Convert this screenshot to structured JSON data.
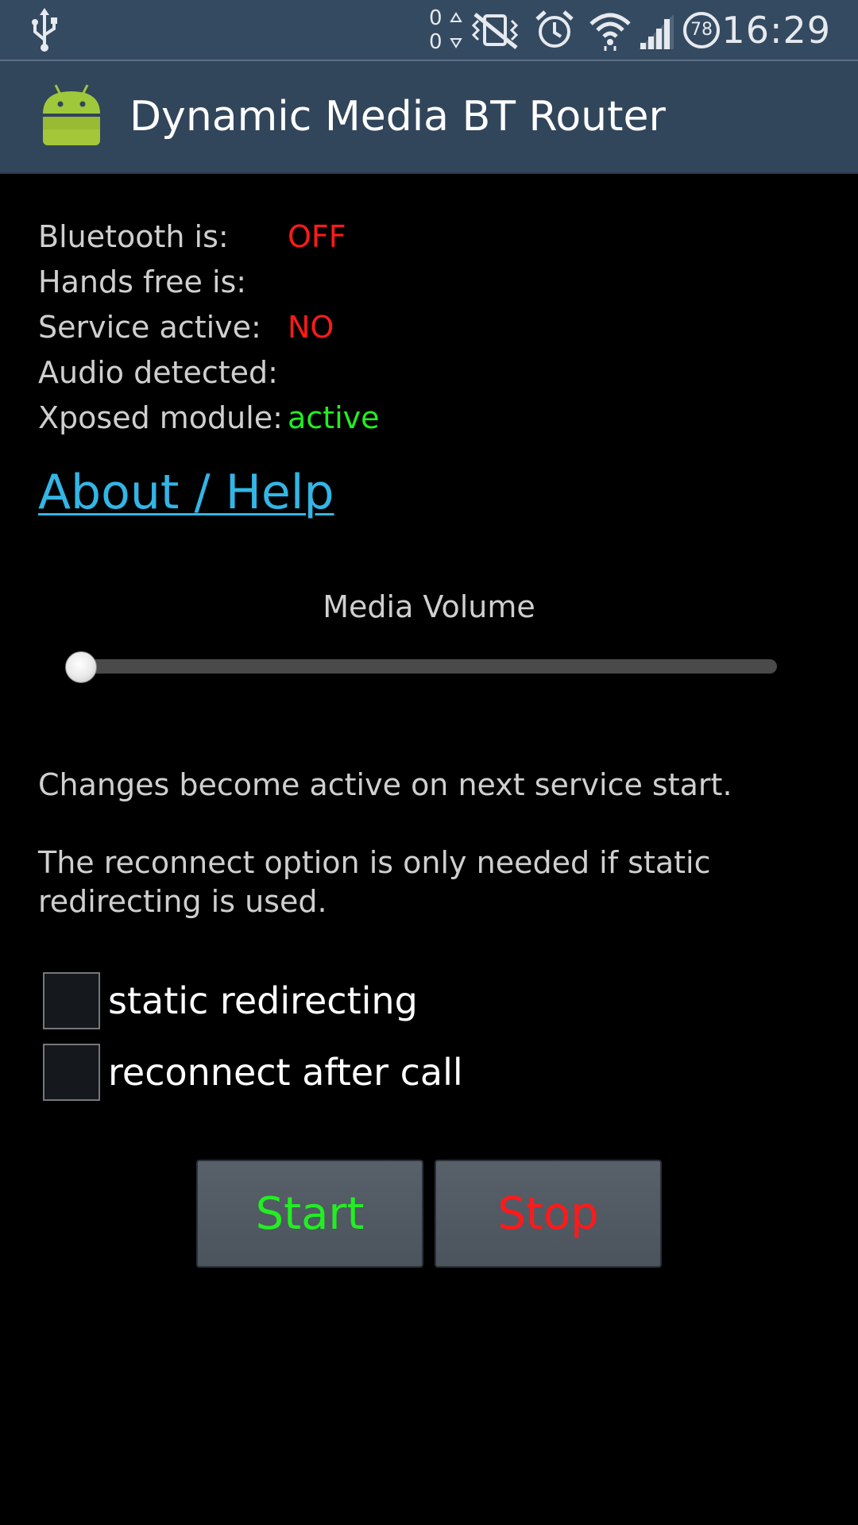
{
  "statusbar": {
    "time": "16:29",
    "battery": "78",
    "data_in": "0",
    "data_out": "0",
    "icons": [
      "usb-icon",
      "data-activity-icon",
      "vibrate-mute-icon",
      "alarm-icon",
      "wifi-icon",
      "signal-icon",
      "battery-icon"
    ]
  },
  "actionbar": {
    "title": "Dynamic Media BT Router",
    "icon": "android-icon"
  },
  "status": {
    "bluetooth_label": "Bluetooth is:",
    "bluetooth_value": "OFF",
    "handsfree_label": "Hands free is:",
    "handsfree_value": "",
    "service_label": "Service active:",
    "service_value": "NO",
    "audio_label": "Audio detected:",
    "audio_value": "",
    "xposed_label": "Xposed module:",
    "xposed_value": "active"
  },
  "help_link": "About / Help",
  "volume": {
    "label": "Media Volume",
    "level": 0
  },
  "notes": {
    "line1": "Changes become active on next service start.",
    "line2": "The reconnect option is only needed if static redirecting is used."
  },
  "options": [
    {
      "label": "static redirecting",
      "checked": false
    },
    {
      "label": "reconnect after call",
      "checked": false
    }
  ],
  "buttons": {
    "start": "Start",
    "stop": "Stop"
  },
  "colors": {
    "off": "#ff1a1a",
    "active": "#22ee22",
    "link": "#33b5e5",
    "statusbar_bg": "#344a61",
    "actionbar_bg": "#31455b"
  }
}
